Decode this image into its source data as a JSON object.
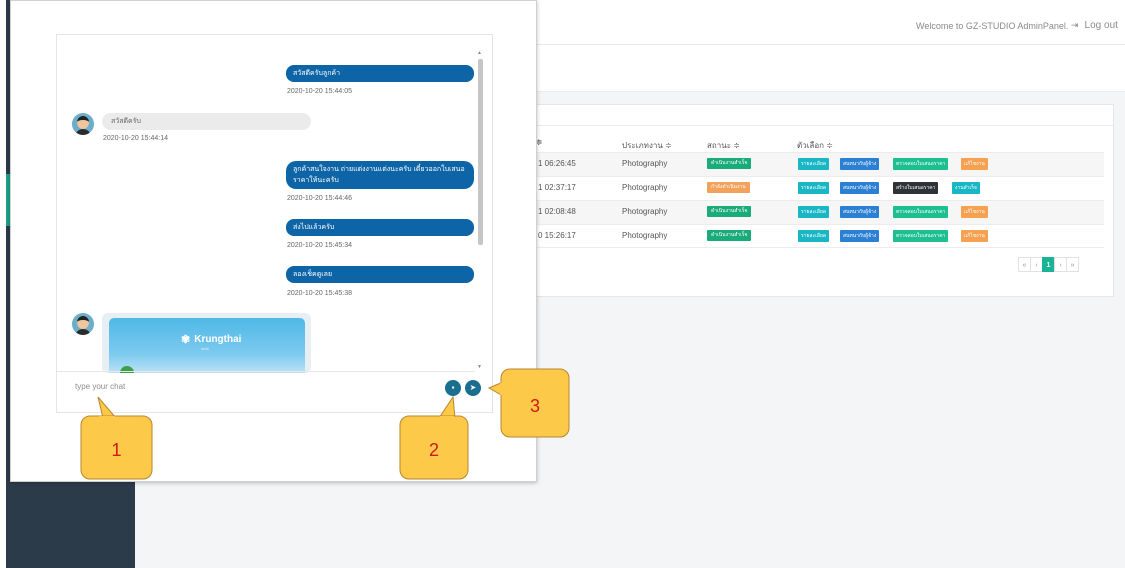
{
  "topbar": {
    "welcome": "Welcome to GZ-STUDIO AdminPanel.",
    "logout_label": "Log out",
    "logout_icon": "sign-out-icon"
  },
  "table": {
    "columns": [
      "",
      "ประเภทงาน ≑",
      "สถานะ ≑",
      "ตัวเลือก ≑"
    ],
    "rows": [
      {
        "date": "1 06:26:45",
        "type": "Photography",
        "status": "ดำเนินงานสำเร็จ",
        "status_color": "#1aab7b",
        "actions": [
          "รายละเอียด",
          "สนทนากับผู้จ้าง",
          "ตรวจสอบใบเสนอราคา",
          "แก้ไขงาน"
        ]
      },
      {
        "date": "1 02:37:17",
        "type": "Photography",
        "status": "กำลังดำเนินงาน",
        "status_color": "#f3a25b",
        "actions": [
          "รายละเอียด",
          "สนทนากับผู้จ้าง",
          "สร้างใบเสนอราคา",
          "งานสำเร็จ"
        ]
      },
      {
        "date": "1 02:08:48",
        "type": "Photography",
        "status": "ดำเนินงานสำเร็จ",
        "status_color": "#1aab7b",
        "actions": [
          "รายละเอียด",
          "สนทนากับผู้จ้าง",
          "ตรวจสอบใบเสนอราคา",
          "แก้ไขงาน"
        ]
      },
      {
        "date": "0 15:26:17",
        "type": "Photography",
        "status": "ดำเนินงานสำเร็จ",
        "status_color": "#1aab7b",
        "actions": [
          "รายละเอียด",
          "สนทนากับผู้จ้าง",
          "ตรวจสอบใบเสนอราคา",
          "แก้ไขงาน"
        ]
      }
    ]
  },
  "pagination": {
    "first": "«",
    "prev": "‹",
    "current": "1",
    "next": "›",
    "last": "»"
  },
  "chat": {
    "messages": [
      {
        "from": "me",
        "text": "สวัสดีครับลูกค้า",
        "time": "2020-10-20 15:44:05"
      },
      {
        "from": "other",
        "text": "สวัสดีครับ",
        "time": "2020-10-20 15:44:14"
      },
      {
        "from": "me",
        "text": "ลูกค้าสนใจงาน ถ่ายแต่งงานแต่งนะครับ เดี๋ยวออกใบเสนอราคาให้นะครับ",
        "time": "2020-10-20 15:44:46"
      },
      {
        "from": "me",
        "text": "ส่งไปแล้วครับ",
        "time": "2020-10-20 15:45:34"
      },
      {
        "from": "me",
        "text": "ลองเช็คดูเลย",
        "time": "2020-10-20 15:45:38"
      }
    ],
    "image_card": {
      "brand": "Krungthai",
      "sub": "next"
    },
    "input_placeholder": "type your chat",
    "file_icon": "file-icon",
    "send_icon": "send-icon"
  },
  "callouts": [
    "1",
    "2",
    "3"
  ],
  "colors": {
    "sidebar": "#2c3b4a",
    "chat_bubble": "#0d64a6",
    "callout": "#fdc949",
    "callout_text": "#d21818"
  }
}
